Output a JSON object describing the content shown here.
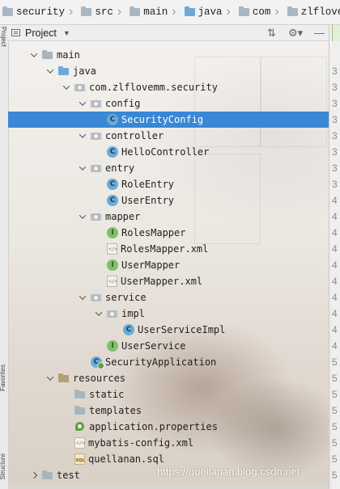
{
  "breadcrumb": [
    {
      "label": "security",
      "icon": "folder-icon",
      "color": "#a8b7c4"
    },
    {
      "label": "src",
      "icon": "folder-icon",
      "color": "#a8b7c4"
    },
    {
      "label": "main",
      "icon": "folder-icon",
      "color": "#a8b7c4"
    },
    {
      "label": "java",
      "icon": "folder-icon",
      "color": "#6fa9d8"
    },
    {
      "label": "com",
      "icon": "folder-icon",
      "color": "#a8b7c4"
    },
    {
      "label": "zlflovemm",
      "icon": "folder-icon",
      "color": "#a8b7c4"
    }
  ],
  "project_panel": {
    "title": "Project",
    "toolbar_icons": [
      "collapse-all-icon",
      "gear-icon",
      "hide-icon"
    ]
  },
  "left_strip": {
    "tabs": [
      "Project",
      "Favorites",
      "Structure"
    ]
  },
  "gutter": {
    "line_numbers": [
      "3",
      "3",
      "3",
      "3",
      "3",
      "3",
      "3",
      "3",
      "4",
      "4",
      "4",
      "4",
      "4",
      "4",
      "4",
      "4",
      "4",
      "4",
      "5",
      "5",
      "5",
      "5",
      "5",
      "5",
      "5",
      "5"
    ]
  },
  "tree": [
    {
      "label": "main",
      "level": 1,
      "arrow": "down",
      "icon": "folder"
    },
    {
      "label": "java",
      "level": 2,
      "arrow": "down",
      "icon": "folder-blue"
    },
    {
      "label": "com.zlflovemm.security",
      "level": 3,
      "arrow": "down",
      "icon": "pkg"
    },
    {
      "label": "config",
      "level": 4,
      "arrow": "down",
      "icon": "pkg"
    },
    {
      "label": "SecurityConfig",
      "level": 5,
      "arrow": "none",
      "icon": "circle-c",
      "glyph": "C",
      "selected": true
    },
    {
      "label": "controller",
      "level": 4,
      "arrow": "down",
      "icon": "pkg"
    },
    {
      "label": "HelloController",
      "level": 5,
      "arrow": "none",
      "icon": "circle-c",
      "glyph": "C"
    },
    {
      "label": "entry",
      "level": 4,
      "arrow": "down",
      "icon": "pkg"
    },
    {
      "label": "RoleEntry",
      "level": 5,
      "arrow": "none",
      "icon": "circle-c",
      "glyph": "C"
    },
    {
      "label": "UserEntry",
      "level": 5,
      "arrow": "none",
      "icon": "circle-c",
      "glyph": "C"
    },
    {
      "label": "mapper",
      "level": 4,
      "arrow": "down",
      "icon": "pkg"
    },
    {
      "label": "RolesMapper",
      "level": 5,
      "arrow": "none",
      "icon": "circle-i",
      "glyph": "I"
    },
    {
      "label": "RolesMapper.xml",
      "level": 5,
      "arrow": "none",
      "icon": "xml"
    },
    {
      "label": "UserMapper",
      "level": 5,
      "arrow": "none",
      "icon": "circle-i",
      "glyph": "I"
    },
    {
      "label": "UserMapper.xml",
      "level": 5,
      "arrow": "none",
      "icon": "xml"
    },
    {
      "label": "service",
      "level": 4,
      "arrow": "down",
      "icon": "pkg"
    },
    {
      "label": "impl",
      "level": 5,
      "arrow": "down",
      "icon": "pkg"
    },
    {
      "label": "UserServiceImpl",
      "level": 6,
      "arrow": "none",
      "icon": "circle-c",
      "glyph": "C"
    },
    {
      "label": "UserService",
      "level": 5,
      "arrow": "none",
      "icon": "circle-i",
      "glyph": "I"
    },
    {
      "label": "SecurityApplication",
      "level": 4,
      "arrow": "none",
      "icon": "spring",
      "glyph": "C"
    },
    {
      "label": "resources",
      "level": 2,
      "arrow": "down",
      "icon": "folder-res"
    },
    {
      "label": "static",
      "level": 3,
      "arrow": "none",
      "icon": "folder"
    },
    {
      "label": "templates",
      "level": 3,
      "arrow": "none",
      "icon": "folder"
    },
    {
      "label": "application.properties",
      "level": 3,
      "arrow": "none",
      "icon": "props"
    },
    {
      "label": "mybatis-config.xml",
      "level": 3,
      "arrow": "none",
      "icon": "xml"
    },
    {
      "label": "quellanan.sql",
      "level": 3,
      "arrow": "none",
      "icon": "sql"
    },
    {
      "label": "test",
      "level": 1,
      "arrow": "right",
      "icon": "folder"
    }
  ],
  "watermark": "https://quellanan.blog.csdn.net"
}
